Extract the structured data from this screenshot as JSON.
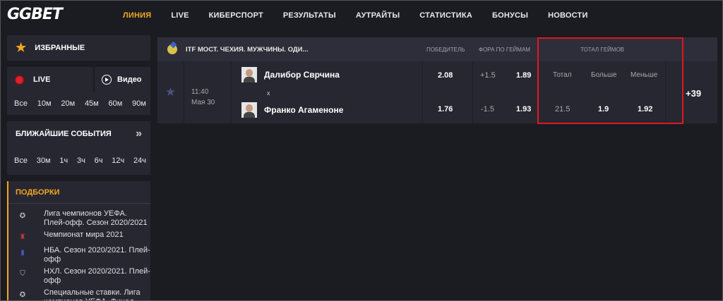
{
  "logo": {
    "left": "GG",
    "right": "BET"
  },
  "nav": [
    {
      "label": "ЛИНИЯ",
      "active": true
    },
    {
      "label": "LIVE"
    },
    {
      "label": "КИБЕРСПОРТ"
    },
    {
      "label": "РЕЗУЛЬТАТЫ"
    },
    {
      "label": "АУТРАЙТЫ"
    },
    {
      "label": "СТАТИСТИКА"
    },
    {
      "label": "БОНУСЫ"
    },
    {
      "label": "НОВОСТИ"
    }
  ],
  "sidebar": {
    "favorites": "ИЗБРАННЫЕ",
    "live": "LIVE",
    "video": "Видео",
    "live_periods": [
      "Все",
      "10м",
      "20м",
      "45м",
      "60м",
      "90м"
    ],
    "nearest": "БЛИЖАЙШИЕ СОБЫТИЯ",
    "nearest_periods": [
      "Все",
      "30м",
      "1ч",
      "3ч",
      "6ч",
      "12ч",
      "24ч"
    ],
    "picks_title": "ПОДБОРКИ",
    "picks": [
      {
        "label": "Лига чемпионов УЕФА. Плей-офф. Сезон 2020/2021",
        "icon": "ucl-icon"
      },
      {
        "label": "Чемпионат мира 2021",
        "icon": "worldcup-icon"
      },
      {
        "label": "НБА. Сезон 2020/2021. Плей-офф",
        "icon": "nba-icon"
      },
      {
        "label": "НХЛ. Сезон 2020/2021. Плей-офф",
        "icon": "nhl-icon"
      },
      {
        "label": "Специальные ставки. Лига чемпионов УЕФА. Финал",
        "icon": "ucl-icon"
      }
    ]
  },
  "header": {
    "league": "ITF МОСТ. ЧЕХИЯ. МУЖЧИНЫ. ОДИ...",
    "winner": "ПОБЕДИТЕЛЬ",
    "handicap": "ФОРА ПО ГЕЙМАМ",
    "total_games": "ТОТАЛ ГЕЙМОВ"
  },
  "match": {
    "time": "11:40",
    "date": "Мая 30",
    "player1": "Далибор Сврчина",
    "player2": "Франко Агаменоне",
    "vs": "x",
    "winner_odds": [
      "2.08",
      "1.76"
    ],
    "handicap": [
      "+1.5",
      "-1.5"
    ],
    "handicap_odds": [
      "1.89",
      "1.93"
    ],
    "total_labels": {
      "total": "Тотал",
      "over": "Больше",
      "under": "Меньше"
    },
    "total_value": "21.5",
    "over_odds": "1.9",
    "under_odds": "1.92",
    "more_markets": "+39"
  },
  "colors": {
    "accent": "#f5a623",
    "highlight": "#e3161e",
    "background": "#1b1c22",
    "panel": "#262731"
  }
}
